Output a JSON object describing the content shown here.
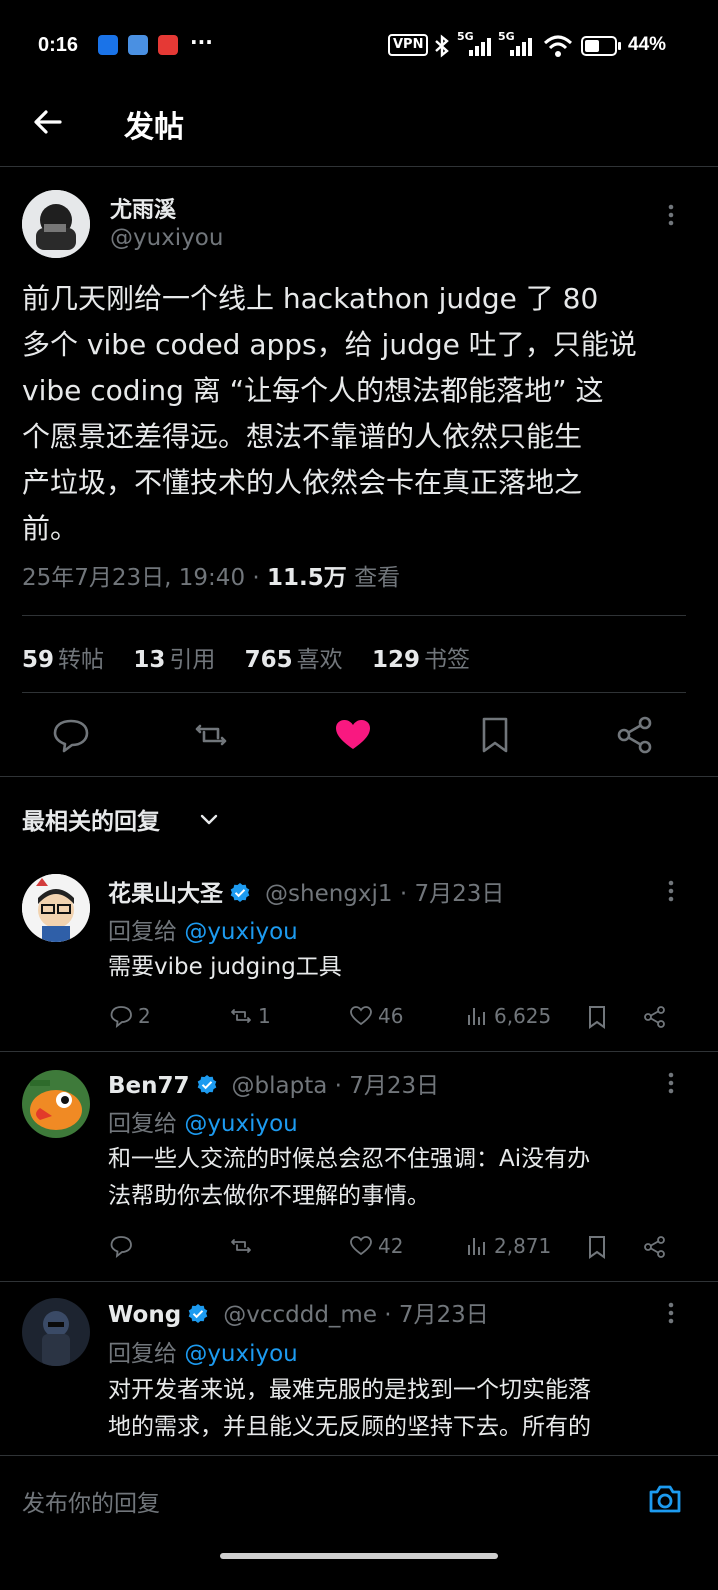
{
  "status_bar": {
    "time": "0:16",
    "more": "···",
    "vpn": "VPN",
    "net1": "5G",
    "net2": "5G",
    "battery": "44%"
  },
  "header": {
    "title": "发帖"
  },
  "main_tweet": {
    "author_name": "尤雨溪",
    "author_handle": "@yuxiyou",
    "body": "前几天刚给一个线上 hackathon judge 了 80\n多个 vibe coded apps，给 judge 吐了，只能说\nvibe coding 离 “让每个人的想法都能落地” 这\n个愿景还差得远。想法不靠谱的人依然只能生\n产垃圾，不懂技术的人依然会卡在真正落地之\n前。",
    "date": "25年7月23日, 19:40 · ",
    "views_count": "11.5万",
    "views_label": " 查看",
    "stats": [
      {
        "num": "59",
        "label": "转帖"
      },
      {
        "num": "13",
        "label": "引用"
      },
      {
        "num": "765",
        "label": "喜欢"
      },
      {
        "num": "129",
        "label": "书签"
      }
    ],
    "liked": true
  },
  "sort": {
    "label": "最相关的回复"
  },
  "replies": [
    {
      "name": "花果山大圣",
      "handle": "@shengxj1 · 7月23日",
      "reply_prefix": "回复给 ",
      "reply_to": "@yuxiyou",
      "text": "需要vibe judging工具",
      "replies": "2",
      "reposts": "1",
      "likes": "46",
      "views": "6,625"
    },
    {
      "name": "Ben77",
      "handle": "@blapta · 7月23日",
      "reply_prefix": "回复给 ",
      "reply_to": "@yuxiyou",
      "text": "和一些人交流的时候总会忍不住强调：Ai没有办\n法帮助你去做你不理解的事情。",
      "replies": "",
      "reposts": "",
      "likes": "42",
      "views": "2,871"
    },
    {
      "name": "Wong",
      "handle": "@vccddd_me · 7月23日",
      "reply_prefix": "回复给 ",
      "reply_to": "@yuxiyou",
      "text": "对开发者来说，最难克服的是找到一个切实能落\n地的需求，并且能义无反顾的坚持下去。所有的"
    }
  ],
  "composer": {
    "placeholder": "发布你的回复"
  },
  "colors": {
    "background": "#000000",
    "text": "#e7e9ea",
    "secondary": "#71767b",
    "link": "#1d9bf0",
    "like": "#f91880",
    "divider": "#2f3336"
  }
}
